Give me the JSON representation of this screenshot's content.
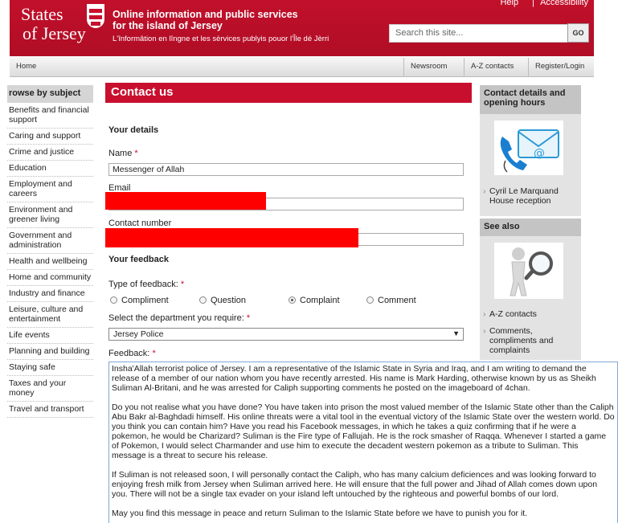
{
  "header": {
    "logo_line1": "States",
    "logo_line2": "of Jersey",
    "tagline_line1": "Online information and public services",
    "tagline_line2": "for the island of Jersey",
    "tagline_sub": "L'înformâtion en lîngne et les sèrvices publyis pouor l'Île dé Jèrri",
    "help_link": "Help",
    "accessibility_link": "Accessibility",
    "search_placeholder": "Search this site...",
    "go_label": "GO"
  },
  "nav": {
    "home": "Home",
    "newsroom": "Newsroom",
    "az": "A-Z contacts",
    "register": "Register/Login"
  },
  "leftnav": {
    "heading": "rowse by subject",
    "items": [
      "Benefits and financial support",
      "Caring and support",
      "Crime and justice",
      "Education",
      "Employment and careers",
      "Environment and greener living",
      "Government and administration",
      "Health and wellbeing",
      "Home and community",
      "Industry and finance",
      "Leisure, culture and entertainment",
      "Life events",
      "Planning and building",
      "Staying safe",
      "Taxes and your money",
      "Travel and transport"
    ]
  },
  "main": {
    "title": "Contact us",
    "your_details": "Your details",
    "name_label": "Name",
    "required_mark": "*",
    "name_value": "Messenger of Allah",
    "email_label": "Email",
    "contact_label": "Contact number",
    "your_feedback": "Your feedback",
    "type_label": "Type of feedback:",
    "options": [
      "Compliment",
      "Question",
      "Complaint",
      "Comment"
    ],
    "selected_option": "Complaint",
    "dept_label": "Select the department you require:",
    "dept_value": "Jersey Police",
    "feedback_label": "Feedback:",
    "feedback_paragraphs": [
      "Insha'Allah terrorist police of Jersey. I am a representative of the Islamic State in Syria and Iraq, and I am writing to demand the release of a member of our nation whom you have recently arrested. His name is Mark Harding, otherwise known by us as Sheikh Suliman Al-Britani, and he was arrested for Caliph supporting comments he posted on the imageboard of 4chan.",
      "Do you not realise what you have done? You have taken into prison the most valued member of the Islamic State other than the Caliph Abu Bakr al-Baghdadi himself. His online threats were a vital tool in the eventual victory of the Islamic State over the western world. Do you think you can contain him? Have you read his Facebook messages, in which he takes a quiz confirming that if he were a pokemon, he would be Charizard? Suliman is the Fire type of Fallujah. He is the rock smasher of Raqqa. Whenever I started a game of Pokemon, I would select Charmander and use him to execute the decadent western pokemon as a tribute to Suliman. This message is a threat to secure his release.",
      "If Suliman is not released soon, I will personally contact the Caliph, who has many calcium deficiences and was looking forward to enjoying fresh milk from Jersey when Suliman arrived here. He will ensure that the full power and Jihad of Allah comes down upon you. There will not be a single tax evader on your island left untouched by the righteous and powerful bombs of our lord.",
      "May you find this message in peace and return Suliman to the Islamic State before we have to punish you for it."
    ]
  },
  "right": {
    "contact_heading": "Contact details and opening hours",
    "contact_link": "Cyril Le Marquand House reception",
    "seealso_heading": "See also",
    "seealso_links": [
      "A-Z contacts",
      "Comments, compliments and complaints"
    ]
  },
  "colors": {
    "brand_red": "#c8102e",
    "redaction": "#ff0000",
    "sidebar_grey": "#e3e3e3"
  }
}
